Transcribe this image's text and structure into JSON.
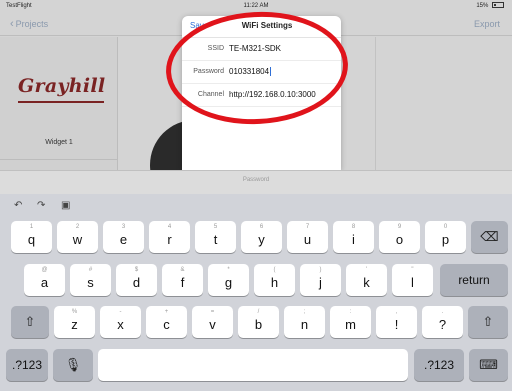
{
  "status_bar": {
    "carrier": "TestFlight",
    "time": "11:22 AM",
    "battery": "15%"
  },
  "nav": {
    "back_label": "Projects",
    "export_label": "Export"
  },
  "sidebar": {
    "logo_text": "Grayhill",
    "widget_label": "Widget 1"
  },
  "modal": {
    "save_label": "Save",
    "title": "WiFi Settings",
    "fields": [
      {
        "label": "SSID",
        "value": "TE-M321-SDK"
      },
      {
        "label": "Password",
        "value": "010331804"
      },
      {
        "label": "Channel",
        "value": "http://192.168.0.10:3000"
      }
    ]
  },
  "keyboard": {
    "hint": "Password",
    "row1": [
      {
        "main": "q",
        "alt": "1"
      },
      {
        "main": "w",
        "alt": "2"
      },
      {
        "main": "e",
        "alt": "3"
      },
      {
        "main": "r",
        "alt": "4"
      },
      {
        "main": "t",
        "alt": "5"
      },
      {
        "main": "y",
        "alt": "6"
      },
      {
        "main": "u",
        "alt": "7"
      },
      {
        "main": "i",
        "alt": "8"
      },
      {
        "main": "o",
        "alt": "9"
      },
      {
        "main": "p",
        "alt": "0"
      }
    ],
    "row2": [
      {
        "main": "a",
        "alt": "@"
      },
      {
        "main": "s",
        "alt": "#"
      },
      {
        "main": "d",
        "alt": "$"
      },
      {
        "main": "f",
        "alt": "&"
      },
      {
        "main": "g",
        "alt": "*"
      },
      {
        "main": "h",
        "alt": "("
      },
      {
        "main": "j",
        "alt": ")"
      },
      {
        "main": "k",
        "alt": "'"
      },
      {
        "main": "l",
        "alt": "\""
      }
    ],
    "row3": [
      {
        "main": "z",
        "alt": "%"
      },
      {
        "main": "x",
        "alt": "-"
      },
      {
        "main": "c",
        "alt": "+"
      },
      {
        "main": "v",
        "alt": "="
      },
      {
        "main": "b",
        "alt": "/"
      },
      {
        "main": "n",
        "alt": ";"
      },
      {
        "main": "m",
        "alt": ":"
      },
      {
        "main": "!",
        "alt": ","
      },
      {
        "main": "?",
        "alt": "."
      }
    ],
    "return_label": "return",
    "numbers_label": ".?123",
    "icons": {
      "undo": "undo-icon",
      "redo": "redo-icon",
      "paste": "paste-icon",
      "delete": "delete-icon",
      "shift": "shift-icon",
      "mic": "microphone-icon",
      "hide": "keyboard-hide-icon"
    }
  },
  "colors": {
    "annotation": "#e0141b",
    "accent": "#2f6fd6",
    "logo": "#7a2323"
  }
}
